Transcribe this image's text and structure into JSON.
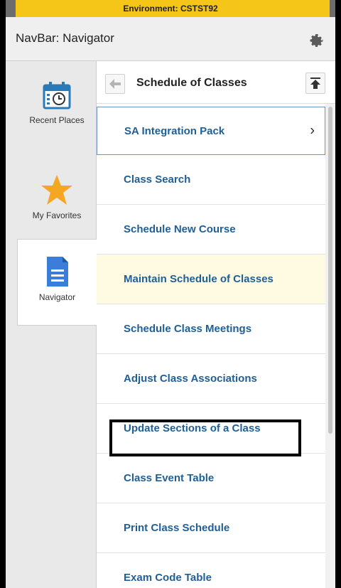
{
  "environment": {
    "text": "Environment: CSTST92"
  },
  "navbar": {
    "title": "NavBar: Navigator",
    "settings_icon": "gear-icon"
  },
  "rail": {
    "items": [
      {
        "label": "Recent Places",
        "icon": "calendar-clock-icon",
        "active": false
      },
      {
        "label": "My Favorites",
        "icon": "star-icon",
        "active": false
      },
      {
        "label": "Navigator",
        "icon": "document-icon",
        "active": true
      }
    ]
  },
  "content": {
    "title": "Schedule of Classes",
    "back_icon": "back-arrow-icon",
    "top_icon": "scroll-to-top-icon",
    "items": [
      {
        "label": "SA Integration Pack",
        "has_chevron": true
      },
      {
        "label": "Class Search"
      },
      {
        "label": "Schedule New Course"
      },
      {
        "label": "Maintain Schedule of Classes",
        "highlighted": true
      },
      {
        "label": "Schedule Class Meetings"
      },
      {
        "label": "Adjust Class Associations",
        "boxed": true
      },
      {
        "label": "Update Sections of a Class"
      },
      {
        "label": "Class Event Table"
      },
      {
        "label": "Print Class Schedule"
      },
      {
        "label": "Exam Code Table"
      }
    ]
  },
  "colors": {
    "env_bar": "#f5c518",
    "link": "#1f5f95",
    "highlight": "#fffbe3",
    "star": "#f5a623",
    "doc": "#3b7dd8"
  }
}
